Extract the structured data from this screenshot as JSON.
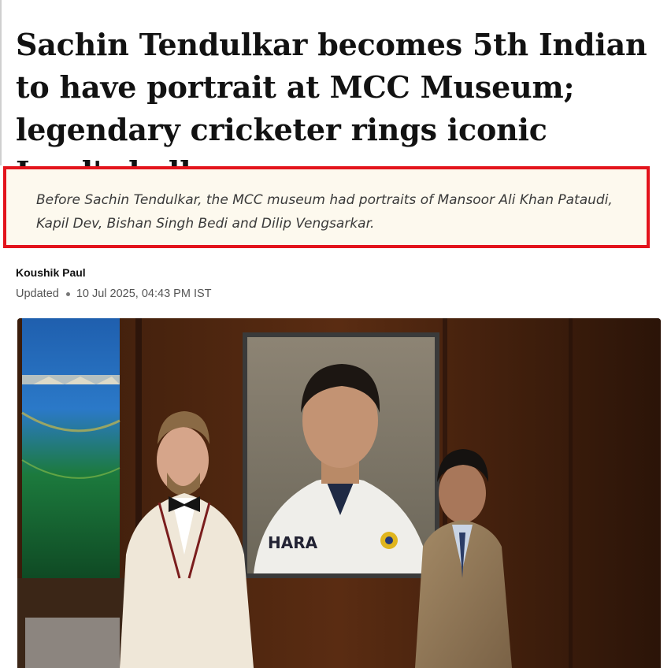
{
  "article": {
    "headline": "Sachin Tendulkar becomes 5th Indian to have portrait at MCC Museum; legendary cricketer rings iconic Lord's bell",
    "summary": "Before Sachin Tendulkar, the MCC museum had portraits of Mansoor Ali Khan Pataudi, Kapil Dev, Bishan Singh Bedi and Dilip Vengsarkar.",
    "author": "Koushik Paul",
    "updated_label": "Updated",
    "date": "10 Jul 2025, 04:43 PM IST",
    "jersey_text": "HARA"
  },
  "colors": {
    "highlight_border": "#e3141c",
    "summary_bg": "#fdf9ee"
  }
}
